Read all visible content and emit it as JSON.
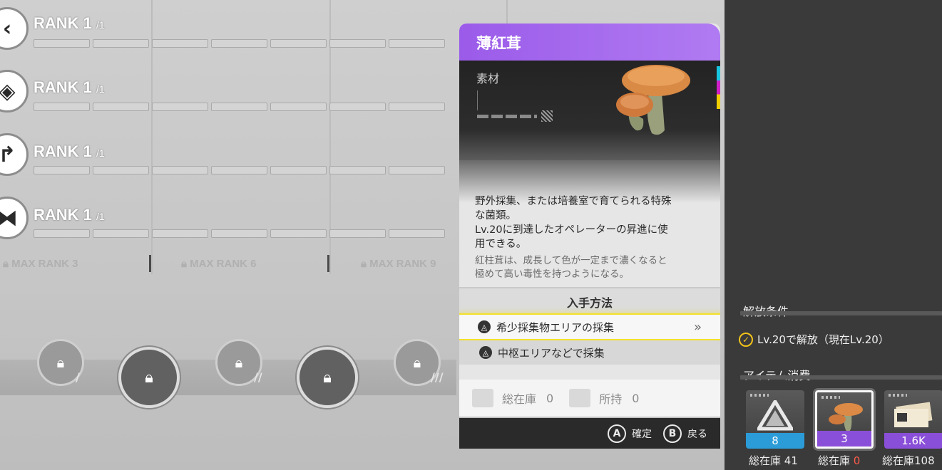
{
  "ranks": [
    {
      "label": "RANK 1",
      "max": "/1",
      "icon": "chevron-icon"
    },
    {
      "label": "RANK 1",
      "max": "/1",
      "icon": "cube-icon"
    },
    {
      "label": "RANK 1",
      "max": "/1",
      "icon": "arrow-icon"
    },
    {
      "label": "RANK 1",
      "max": "/1",
      "icon": "link-icon"
    }
  ],
  "max_ranks": [
    "MAX RANK 3",
    "MAX RANK 6",
    "MAX RANK 9"
  ],
  "item": {
    "name": "薄紅茸",
    "category": "素材",
    "description_lines": [
      "野外採集、または培養室で育てられる特殊",
      "な菌類。",
      "Lv.20に到達したオペレーターの昇進に使",
      "用できる。"
    ],
    "lore_lines": [
      "紅柱茸は、成長して色が一定まで濃くなると",
      "極めて高い毒性を持つようになる。"
    ],
    "acquisition_title": "入手方法",
    "acquisition": [
      {
        "label": "希少採集物エリアの採集",
        "chevron": "»"
      },
      {
        "label": "中枢エリアなどで採集"
      }
    ],
    "footer": {
      "storage_label": "総在庫",
      "storage_value": "0",
      "owned_label": "所持",
      "owned_value": "0"
    }
  },
  "buttons": {
    "confirm_key": "A",
    "confirm_label": "確定",
    "back_key": "B",
    "back_label": "戻る"
  },
  "unlock": {
    "title": "解放条件",
    "condition": "Lv.20で解放（現在Lv.20）"
  },
  "consume": {
    "title": "アイテム消費",
    "items": [
      {
        "count": "8",
        "stock_label": "総在庫",
        "stock": "41",
        "icon": "crystal-icon",
        "accent": "#2b9cd8"
      },
      {
        "count": "3",
        "stock_label": "総在庫",
        "stock": "0",
        "icon": "mushroom-icon",
        "accent": "#8a4fd8"
      },
      {
        "count": "1.6K",
        "stock_label": "総在庫",
        "stock": "108",
        "icon": "banknote-icon",
        "accent": "#8a4fd8"
      }
    ]
  },
  "colors": {
    "title_bar": "#9b5be9",
    "highlight": "#f3e12b",
    "check": "#f2c318",
    "stock_zero": "#ff5b4a"
  }
}
